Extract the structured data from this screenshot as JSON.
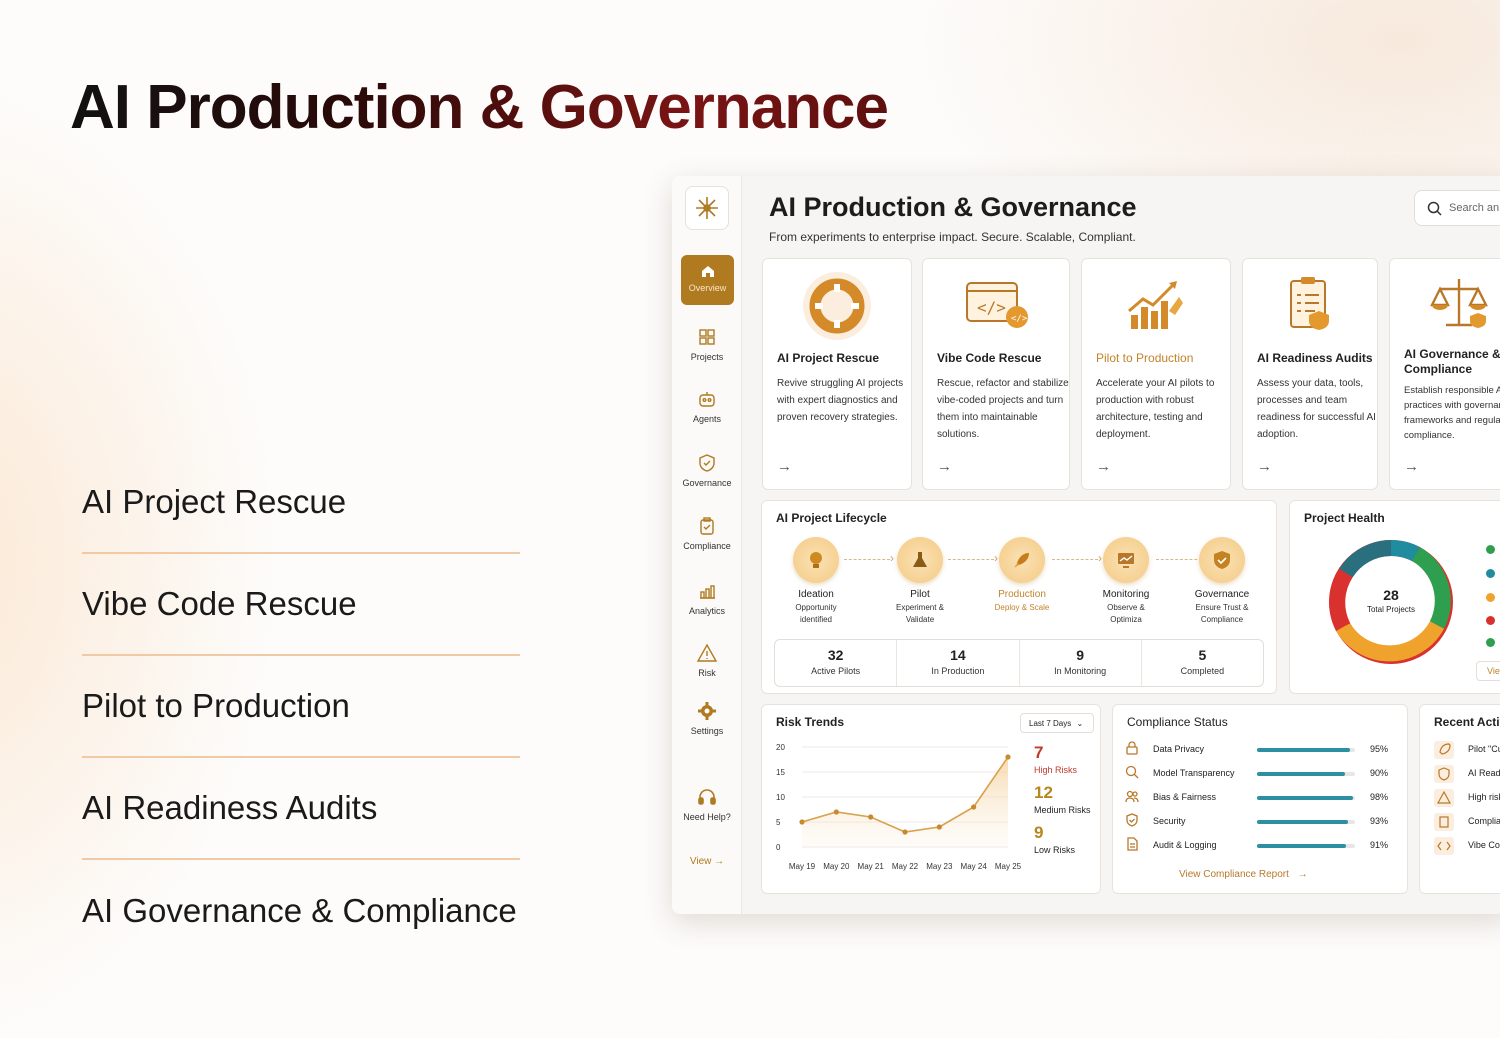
{
  "hero": {
    "title": "AI Production & Governance"
  },
  "menu": [
    "AI Project Rescue",
    "Vibe Code Rescue",
    "Pilot to Production",
    "AI Readiness Audits",
    "AI Governance & Compliance"
  ],
  "app": {
    "title": "AI Production & Governance",
    "subtitle": "From experiments to enterprise impact. Secure. Scalable, Compliant.",
    "search_placeholder": "Search an",
    "sidebar": [
      {
        "label": "Overview",
        "icon": "home-icon"
      },
      {
        "label": "Projects",
        "icon": "projects-icon"
      },
      {
        "label": "Agents",
        "icon": "robot-icon"
      },
      {
        "label": "Governance",
        "icon": "shield-icon"
      },
      {
        "label": "Compliance",
        "icon": "clipboard-check-icon"
      },
      {
        "label": "Analytics",
        "icon": "bar-chart-icon"
      },
      {
        "label": "Risk",
        "icon": "warning-icon"
      },
      {
        "label": "Settings",
        "icon": "gear-icon"
      },
      {
        "label": "Need Help?",
        "icon": "headset-icon"
      }
    ],
    "sidebar_view": "View",
    "cards": [
      {
        "title": "AI Project Rescue",
        "desc": "Revive struggling AI projects with expert diagnostics and proven recovery strategies.",
        "icon": "lifebuoy-icon",
        "highlight": false
      },
      {
        "title": "Vibe Code Rescue",
        "desc": "Rescue, refactor and stabilize vibe-coded projects and turn them into maintainable solutions.",
        "icon": "code-window-icon",
        "highlight": false
      },
      {
        "title": "Pilot to Production",
        "desc": "Accelerate your AI pilots to production with robust architecture, testing and deployment.",
        "icon": "growth-rocket-icon",
        "highlight": true
      },
      {
        "title": "AI Readiness Audits",
        "desc": "Assess your data, tools, processes and team readiness for successful AI adoption.",
        "icon": "audit-clipboard-icon",
        "highlight": false
      },
      {
        "title": "AI Governance & Compliance",
        "desc": "Establish responsible AI practices with governan frameworks and regulat compliance.",
        "icon": "scales-icon",
        "highlight": false
      }
    ],
    "lifecycle": {
      "title": "AI Project Lifecycle",
      "stages": [
        {
          "name": "Ideation",
          "desc": "Opportunity identified",
          "icon": "lightbulb-icon",
          "highlight": false
        },
        {
          "name": "Pilot",
          "desc": "Experiment & Validate",
          "icon": "flask-icon",
          "highlight": false
        },
        {
          "name": "Production",
          "desc": "Deploy & Scale",
          "icon": "rocket-icon",
          "highlight": true
        },
        {
          "name": "Monitoring",
          "desc": "Observe & Optimiza",
          "icon": "monitor-chart-icon",
          "highlight": false
        },
        {
          "name": "Governance",
          "desc": "Ensure Trust & Compliance",
          "icon": "shield-check-icon",
          "highlight": false
        }
      ],
      "stats": [
        {
          "value": "32",
          "label": "Active Pilots"
        },
        {
          "value": "14",
          "label": "In Production"
        },
        {
          "value": "9",
          "label": "In Monitoring"
        },
        {
          "value": "5",
          "label": "Completed"
        }
      ]
    },
    "health": {
      "title": "Project Health",
      "total": "28",
      "total_label": "Total Projects",
      "view": "Vie",
      "legend_colors": [
        "#2e9e4f",
        "#1f8ca0",
        "#f0a32c",
        "#d9322e",
        "#2e9e4f"
      ]
    },
    "risk": {
      "title": "Risk Trends",
      "period": "Last 7 Days",
      "counts": [
        {
          "value": "7",
          "label": "High Risks",
          "color": "#c0392b"
        },
        {
          "value": "12",
          "label": "Medium Risks",
          "color": "#b8861f"
        },
        {
          "value": "9",
          "label": "Low Risks",
          "color": "#b8861f"
        }
      ]
    },
    "compliance": {
      "title": "Compliance Status",
      "items": [
        {
          "name": "Data Privacy",
          "pct": "95%",
          "value": 95,
          "icon": "lock-icon"
        },
        {
          "name": "Model Transparency",
          "pct": "90%",
          "value": 90,
          "icon": "search-icon"
        },
        {
          "name": "Bias & Fairness",
          "pct": "98%",
          "value": 98,
          "icon": "users-icon"
        },
        {
          "name": "Security",
          "pct": "93%",
          "value": 93,
          "icon": "shield-icon"
        },
        {
          "name": "Audit & Logging",
          "pct": "91%",
          "value": 91,
          "icon": "document-icon"
        }
      ],
      "link": "View Compliance Report"
    },
    "activity": {
      "title": "Recent Activ",
      "items": [
        {
          "text": "Pilot \"Cu",
          "icon": "rocket-icon"
        },
        {
          "text": "AI Readi",
          "icon": "shield-icon"
        },
        {
          "text": "High risk",
          "icon": "warning-icon"
        },
        {
          "text": "Complia",
          "icon": "clipboard-icon"
        },
        {
          "text": "Vibe Co",
          "icon": "code-icon"
        }
      ]
    }
  },
  "chart_data": {
    "type": "area",
    "title": "Risk Trends",
    "categories": [
      "May 19",
      "May 20",
      "May 21",
      "May 22",
      "May 23",
      "May 24",
      "May 25"
    ],
    "series": [
      {
        "values": [
          5,
          7,
          6,
          3,
          4,
          8,
          18
        ]
      }
    ],
    "ylim": [
      0,
      20
    ],
    "yticks": [
      0,
      5,
      10,
      15,
      20
    ],
    "grid": true
  }
}
